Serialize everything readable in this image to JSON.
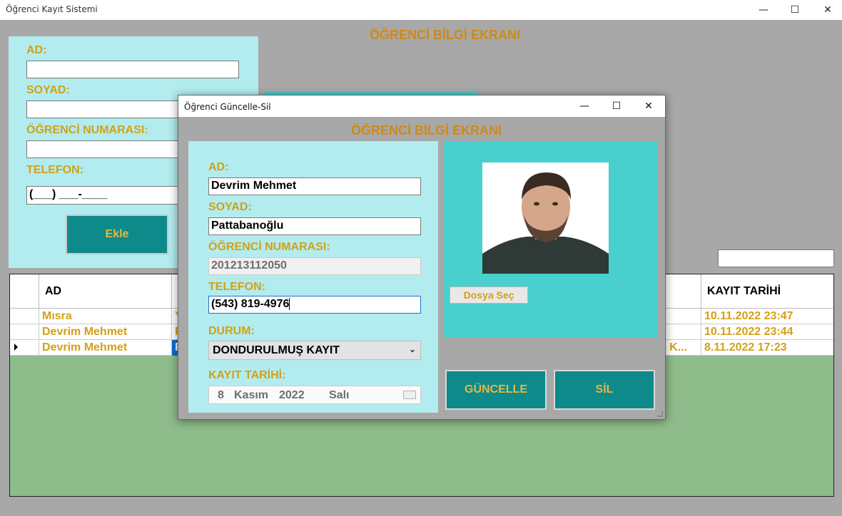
{
  "main_window": {
    "title": "Öğrenci Kayıt Sistemi",
    "minimize_glyph": "—",
    "maximize_glyph": "☐",
    "close_glyph": "✕",
    "heading": "ÖĞRENCİ BİLGİ EKRANI"
  },
  "add_form": {
    "ad_label": "AD:",
    "soyad_label": "SOYAD:",
    "numara_label": "ÖĞRENCİ NUMARASI:",
    "telefon_label": "TELEFON:",
    "telefon_mask": "(___) ___-____",
    "ekle_label": "Ekle"
  },
  "grid": {
    "columns": [
      "AD",
      "KAYIT TARİHİ"
    ],
    "rows": [
      {
        "ad": "Mısra",
        "col2_fragment": "Y",
        "col_mid_fragment": "",
        "kayit_tarihi": "10.11.2022 23:47"
      },
      {
        "ad": "Devrim Mehmet",
        "col2_fragment": "P",
        "col_mid_fragment": "",
        "kayit_tarihi": "10.11.2022 23:44"
      },
      {
        "ad": "Devrim Mehmet",
        "col2_fragment": "P",
        "col_mid_fragment": "Ş K...",
        "kayit_tarihi": "8.11.2022 17:23"
      }
    ]
  },
  "dialog": {
    "title": "Öğrenci Güncelle-Sil",
    "minimize_glyph": "—",
    "maximize_glyph": "☐",
    "close_glyph": "✕",
    "heading": "ÖĞRENCİ BİLGİ EKRANI",
    "ad_label": "AD:",
    "ad_value": "Devrim Mehmet",
    "soyad_label": "SOYAD:",
    "soyad_value": "Pattabanoğlu",
    "numara_label": "ÖĞRENCİ NUMARASI:",
    "numara_value": "201213112050",
    "telefon_label": "TELEFON:",
    "telefon_value": "(543) 819-4976",
    "durum_label": "DURUM:",
    "durum_value": "DONDURULMUŞ KAYIT",
    "kayit_tarihi_label": "KAYIT TARİHİ:",
    "date_day": "8",
    "date_month": "Kasım",
    "date_year": "2022",
    "date_weekday": "Salı",
    "dosya_sec_label": "Dosya Seç",
    "guncelle_label": "GÜNCELLE",
    "sil_label": "SİL"
  },
  "colors": {
    "label_gold": "#d4a017",
    "heading_orange": "#cc8a1a",
    "button_teal": "#0e8a8a",
    "panel_cyan": "#b2ecee",
    "photo_panel": "#48cfce",
    "grid_bg": "#8fbc8b"
  }
}
